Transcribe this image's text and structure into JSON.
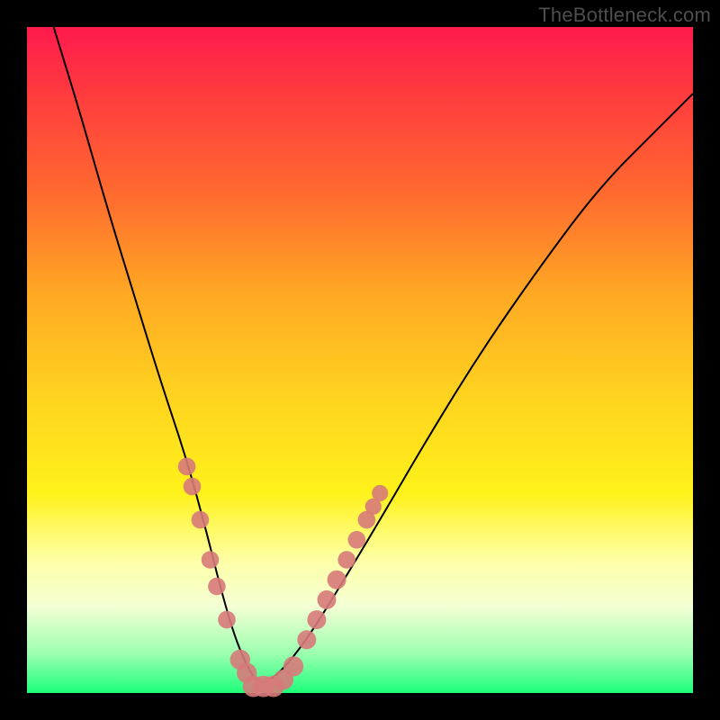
{
  "watermark": "TheBottleneck.com",
  "chart_data": {
    "type": "line",
    "title": "",
    "xlabel": "",
    "ylabel": "",
    "xlim": [
      0,
      100
    ],
    "ylim": [
      0,
      100
    ],
    "grid": false,
    "legend": false,
    "series": [
      {
        "name": "bottleneck-curve",
        "color": "#000000",
        "x": [
          4,
          8,
          12,
          16,
          20,
          24,
          27,
          29,
          31,
          33,
          35,
          38,
          42,
          47,
          53,
          60,
          68,
          77,
          86,
          95,
          100
        ],
        "y": [
          100,
          87,
          73,
          60,
          47,
          35,
          24,
          16,
          9,
          4,
          1,
          3,
          8,
          16,
          26,
          38,
          51,
          64,
          76,
          85,
          90
        ]
      }
    ],
    "markers": [
      {
        "name": "left-cluster-1",
        "x": 24.0,
        "y": 34,
        "r": 1.4
      },
      {
        "name": "left-cluster-2",
        "x": 24.8,
        "y": 31,
        "r": 1.4
      },
      {
        "name": "left-cluster-3",
        "x": 26.0,
        "y": 26,
        "r": 1.4
      },
      {
        "name": "left-cluster-4",
        "x": 27.5,
        "y": 20,
        "r": 1.4
      },
      {
        "name": "left-cluster-5",
        "x": 28.5,
        "y": 16,
        "r": 1.4
      },
      {
        "name": "left-cluster-6",
        "x": 30.0,
        "y": 11,
        "r": 1.4
      },
      {
        "name": "bottom-1",
        "x": 32.0,
        "y": 5,
        "r": 1.6
      },
      {
        "name": "bottom-2",
        "x": 33.0,
        "y": 3,
        "r": 1.6
      },
      {
        "name": "bottom-3",
        "x": 34.0,
        "y": 1,
        "r": 1.7
      },
      {
        "name": "bottom-4",
        "x": 35.5,
        "y": 1,
        "r": 1.7
      },
      {
        "name": "bottom-5",
        "x": 37.0,
        "y": 1,
        "r": 1.7
      },
      {
        "name": "bottom-6",
        "x": 38.5,
        "y": 2,
        "r": 1.6
      },
      {
        "name": "bottom-7",
        "x": 40.0,
        "y": 4,
        "r": 1.6
      },
      {
        "name": "right-cluster-1",
        "x": 42.0,
        "y": 8,
        "r": 1.5
      },
      {
        "name": "right-cluster-2",
        "x": 43.5,
        "y": 11,
        "r": 1.5
      },
      {
        "name": "right-cluster-3",
        "x": 45.0,
        "y": 14,
        "r": 1.5
      },
      {
        "name": "right-cluster-4",
        "x": 46.5,
        "y": 17,
        "r": 1.5
      },
      {
        "name": "right-cluster-5",
        "x": 48.0,
        "y": 20,
        "r": 1.4
      },
      {
        "name": "right-cluster-6",
        "x": 49.5,
        "y": 23,
        "r": 1.4
      },
      {
        "name": "right-cluster-7",
        "x": 51.0,
        "y": 26,
        "r": 1.4
      },
      {
        "name": "right-cluster-8",
        "x": 52.0,
        "y": 28,
        "r": 1.3
      },
      {
        "name": "right-cluster-9",
        "x": 53.0,
        "y": 30,
        "r": 1.3
      }
    ],
    "marker_color": "#d77a7a",
    "background_gradient": {
      "top": "#ff1a4d",
      "mid1": "#ffa823",
      "mid2": "#fff21a",
      "bottom": "#1cff7a"
    }
  }
}
